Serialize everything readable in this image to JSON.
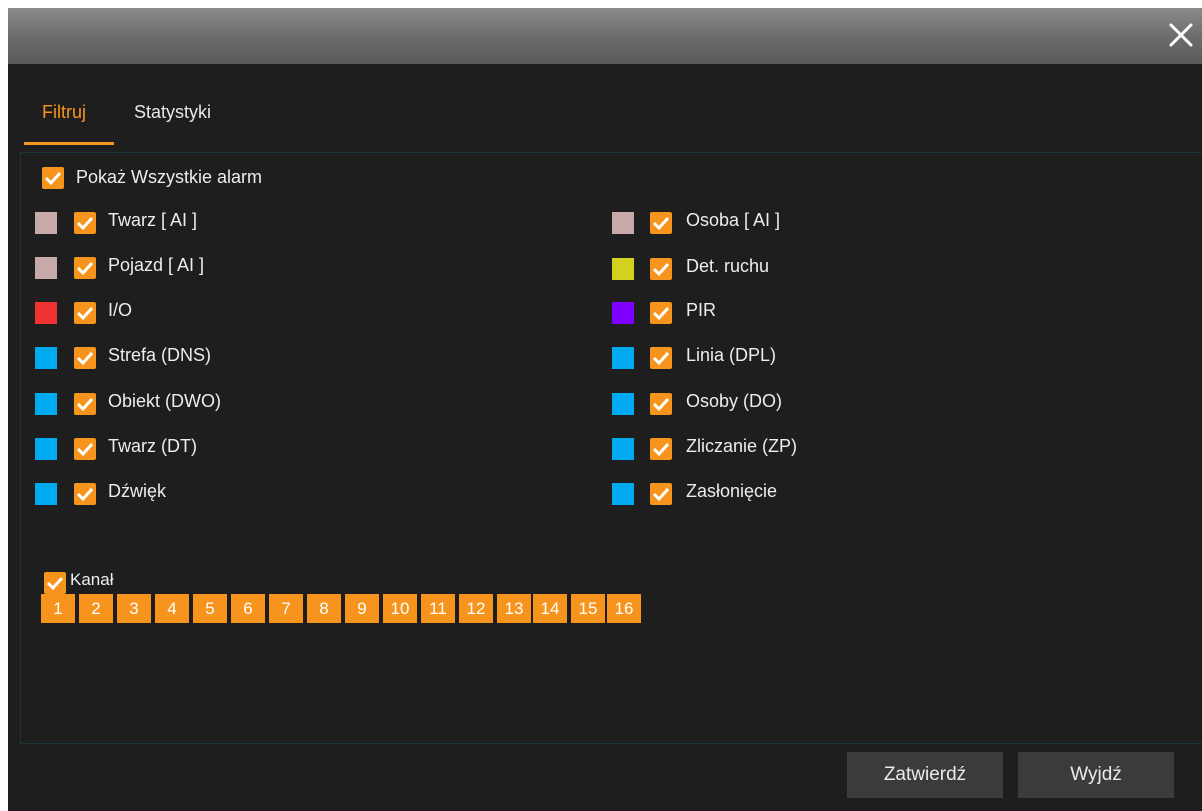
{
  "tabs": [
    {
      "label": "Filtruj"
    },
    {
      "label": "Statystyki"
    }
  ],
  "show_all": {
    "label": "Pokaż Wszystkie alarm",
    "checked": true
  },
  "alarms_left": [
    {
      "label": "Twarz   [ AI ]",
      "color": "#c8a9a9",
      "checked": true
    },
    {
      "label": "Pojazd   [ AI ]",
      "color": "#c8a9a9",
      "checked": true
    },
    {
      "label": "I/O",
      "color": "#f03232",
      "checked": true
    },
    {
      "label": "Strefa (DNS)",
      "color": "#00aaf0",
      "checked": true
    },
    {
      "label": "Obiekt (DWO)",
      "color": "#00aaf0",
      "checked": true
    },
    {
      "label": "Twarz (DT)",
      "color": "#00aaf0",
      "checked": true
    },
    {
      "label": "Dźwięk",
      "color": "#00aaf0",
      "checked": true
    }
  ],
  "alarms_right": [
    {
      "label": "Osoba   [ AI ]",
      "color": "#c8a9a9",
      "checked": true
    },
    {
      "label": "Det. ruchu",
      "color": "#d4d020",
      "checked": true
    },
    {
      "label": "PIR",
      "color": "#8000ff",
      "checked": true
    },
    {
      "label": "Linia (DPL)",
      "color": "#00aaf0",
      "checked": true
    },
    {
      "label": "Osoby (DO)",
      "color": "#00aaf0",
      "checked": true
    },
    {
      "label": "Zliczanie (ZP)",
      "color": "#00aaf0",
      "checked": true
    },
    {
      "label": "Zasłonięcie",
      "color": "#00aaf0",
      "checked": true
    }
  ],
  "channel": {
    "label": "Kanał",
    "checked": true,
    "channels": [
      "1",
      "2",
      "3",
      "4",
      "5",
      "6",
      "7",
      "8",
      "9",
      "10",
      "11",
      "12",
      "13",
      "14",
      "15",
      "16"
    ]
  },
  "buttons": {
    "confirm": "Zatwierdź",
    "exit": "Wyjdź"
  },
  "colors": {
    "accent": "#f7941d",
    "background": "#1e1e1e",
    "button": "#3b3b3b"
  },
  "icons": {
    "close": "close-icon",
    "checkbox": "checkmark-icon"
  }
}
